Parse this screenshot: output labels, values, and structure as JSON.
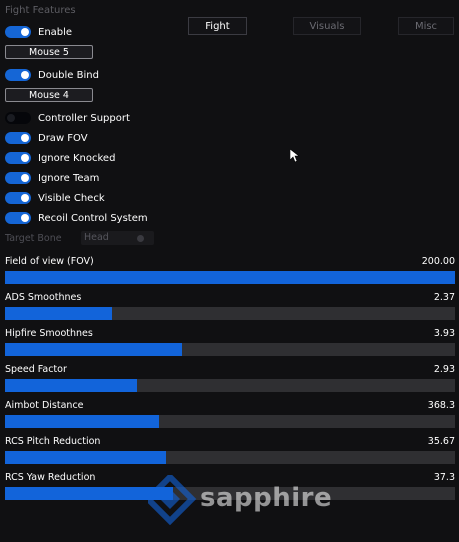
{
  "section_title": "Fight Features",
  "tabs": [
    {
      "label": "Fight",
      "active": true
    },
    {
      "label": "Visuals",
      "active": false
    },
    {
      "label": "Misc",
      "active": false
    }
  ],
  "toggles": {
    "enable": {
      "label": "Enable",
      "on": true
    },
    "double_bind": {
      "label": "Double Bind",
      "on": true
    },
    "controller_support": {
      "label": "Controller Support",
      "on": false
    },
    "draw_fov": {
      "label": "Draw FOV",
      "on": true
    },
    "ignore_knocked": {
      "label": "Ignore Knocked",
      "on": true
    },
    "ignore_team": {
      "label": "Ignore Team",
      "on": true
    },
    "visible_check": {
      "label": "Visible Check",
      "on": true
    },
    "recoil_control": {
      "label": "Recoil Control System",
      "on": true
    }
  },
  "keybinds": {
    "primary": "Mouse 5",
    "secondary": "Mouse 4"
  },
  "target_bone": {
    "label": "Target Bone",
    "value": "Head"
  },
  "sliders": [
    {
      "label": "Field of view (FOV)",
      "value": "200.00",
      "fraction": 1.0
    },
    {
      "label": "ADS Smoothnes",
      "value": "2.37",
      "fraction": 0.237
    },
    {
      "label": "Hipfire Smoothnes",
      "value": "3.93",
      "fraction": 0.393
    },
    {
      "label": "Speed Factor",
      "value": "2.93",
      "fraction": 0.293
    },
    {
      "label": "Aimbot Distance",
      "value": "368.3",
      "fraction": 0.342
    },
    {
      "label": "RCS Pitch Reduction",
      "value": "35.67",
      "fraction": 0.357
    },
    {
      "label": "RCS Yaw Reduction",
      "value": "37.3",
      "fraction": 0.373
    }
  ],
  "watermark": "sapphire",
  "colors": {
    "accent": "#1264da",
    "background": "#101012",
    "track": "#2f2f32"
  }
}
